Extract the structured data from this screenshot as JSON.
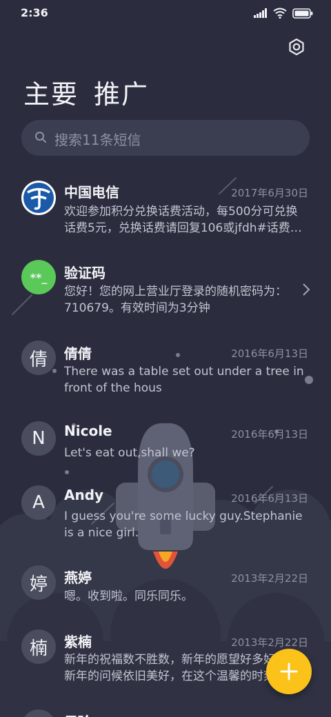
{
  "status": {
    "time": "2:36"
  },
  "tabs": [
    "主要",
    "推广"
  ],
  "search": {
    "placeholder": "搜索11条短信"
  },
  "conversations": [
    {
      "avatar_text": "",
      "avatar_icon": "china-telecom-logo-icon",
      "name": "中国电信",
      "date": "2017年6月30日",
      "preview": "欢迎参加积分兑换话费活动，每500分可兑换话费5元，兑换话费请回复106或jfdh#话费…"
    },
    {
      "avatar_text": "**_",
      "name": "验证码",
      "date": "",
      "preview": "您好！您的网上营业厅登录的随机密码为：710679。有效时间为3分钟"
    },
    {
      "avatar_text": "倩",
      "name": "倩倩",
      "date": "2016年6月13日",
      "preview": "There was a table set out under a tree in front of the hous"
    },
    {
      "avatar_text": "N",
      "name": "Nicole",
      "date": "2016年6月13日",
      "preview": "Let's eat out,shall we?"
    },
    {
      "avatar_text": "A",
      "name": "Andy",
      "date": "2016年6月13日",
      "preview": "I guess you're some lucky guy.Stephanie is a nice girl."
    },
    {
      "avatar_text": "婷",
      "name": "燕婷",
      "date": "2013年2月22日",
      "preview": "嗯。收到啦。同乐同乐。"
    },
    {
      "avatar_text": "楠",
      "name": "紫楠",
      "date": "2013年2月22日",
      "preview": "新年的祝福数不胜数，新年的愿望好多好多，新年的问候依旧美好，在这个温馨的时刻…"
    },
    {
      "avatar_text": "",
      "name": "子玲",
      "date": "",
      "preview": ""
    }
  ],
  "colors": {
    "background": "#2b2d3e",
    "accent": "#fbc21a",
    "verify_avatar": "#5bc85a",
    "telecom_blue": "#1a5aa8"
  }
}
